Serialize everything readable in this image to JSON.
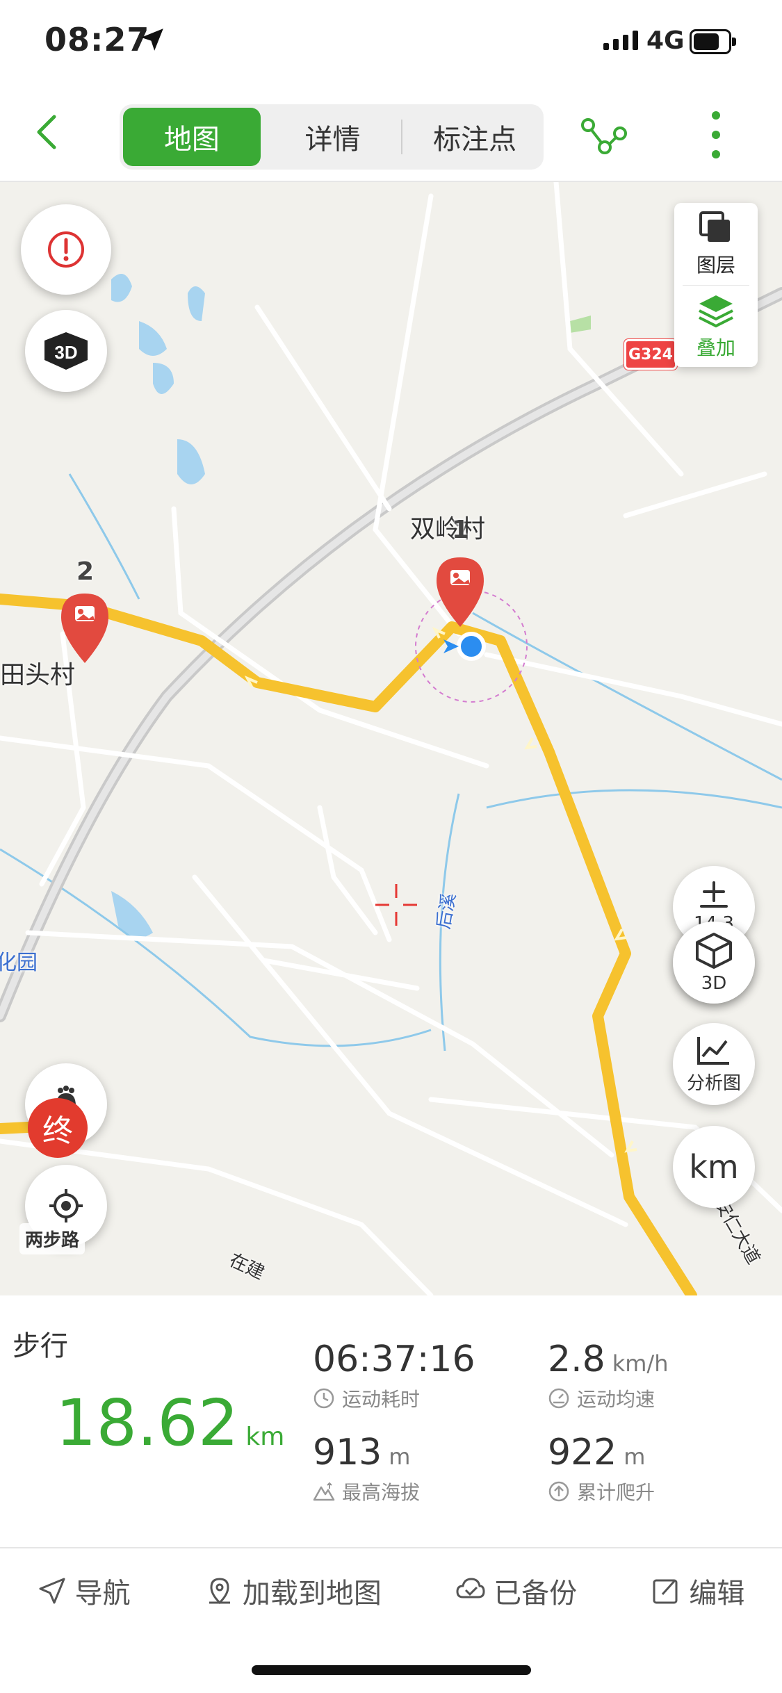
{
  "status": {
    "time": "08:27",
    "network": "4G"
  },
  "nav": {
    "tabs": [
      {
        "label": "地图",
        "active": true
      },
      {
        "label": "详情"
      },
      {
        "label": "标注点"
      }
    ]
  },
  "map": {
    "layers_label": "图层",
    "overlay_label": "叠加",
    "zoom_level": "14.3",
    "btn_3d_label": "3D",
    "analysis_label": "分析图",
    "unit_label": "km",
    "labels": {
      "village1": "双岭村",
      "village2": "田头村",
      "park": "文化园",
      "stream": "后溪",
      "road1": "在建",
      "road2": "安仁大道"
    },
    "pin_numbers": [
      "1",
      "2"
    ],
    "road_shield": "G324",
    "end_marker": "终",
    "watermark": "两步路"
  },
  "stats": {
    "mode": "步行",
    "distance": "18.62",
    "distance_unit": "km",
    "duration": "06:37:16",
    "duration_label": "运动耗时",
    "avg_speed": "2.8",
    "avg_speed_unit": "km/h",
    "avg_speed_label": "运动均速",
    "max_alt": "913",
    "max_alt_unit": "m",
    "max_alt_label": "最高海拔",
    "climb": "922",
    "climb_unit": "m",
    "climb_label": "累计爬升"
  },
  "actions": [
    {
      "label": "导航",
      "icon": "navigation-arrow-icon"
    },
    {
      "label": "加载到地图",
      "icon": "location-pin-icon"
    },
    {
      "label": "已备份",
      "icon": "cloud-check-icon"
    },
    {
      "label": "编辑",
      "icon": "edit-icon"
    }
  ],
  "colors": {
    "accent": "#3aaa35",
    "track": "#f6c22e",
    "pin": "#e24a3f"
  }
}
